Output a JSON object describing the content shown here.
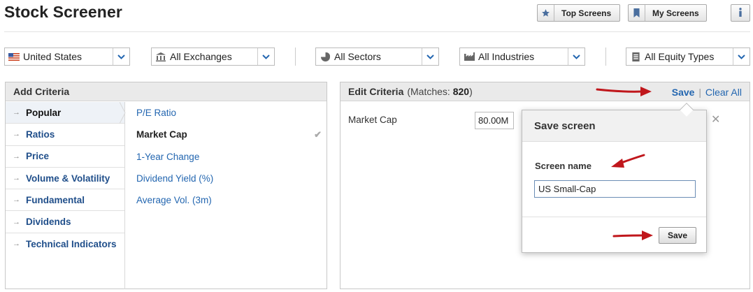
{
  "header": {
    "title": "Stock Screener",
    "top_screens_label": "Top Screens",
    "my_screens_label": "My Screens"
  },
  "filters": {
    "country": "United States",
    "exchange": "All Exchanges",
    "sector": "All Sectors",
    "industry": "All Industries",
    "equity_type": "All Equity Types"
  },
  "add_criteria": {
    "title": "Add Criteria",
    "categories": [
      "Popular",
      "Ratios",
      "Price",
      "Volume & Volatility",
      "Fundamental",
      "Dividends",
      "Technical Indicators"
    ],
    "active_category": "Popular",
    "criteria": [
      "P/E Ratio",
      "Market Cap",
      "1-Year Change",
      "Dividend Yield (%)",
      "Average Vol. (3m)"
    ],
    "selected_criterion": "Market Cap"
  },
  "edit_criteria": {
    "title": "Edit Criteria",
    "matches_prefix": "(Matches: ",
    "matches_count": "820",
    "matches_suffix": ")",
    "save_label": "Save",
    "separator": "|",
    "clear_label": "Clear All",
    "row_label": "Market Cap",
    "row_value": "80.00M"
  },
  "save_dialog": {
    "title": "Save screen",
    "field_label": "Screen name",
    "field_value": "US Small-Cap",
    "save_button": "Save"
  },
  "colors": {
    "link": "#2366b0",
    "annotation_arrow": "#c0171c"
  }
}
